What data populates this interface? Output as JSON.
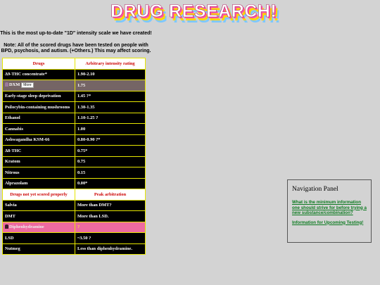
{
  "logo": {
    "text": "DRUG RESEARCH!"
  },
  "intro": {
    "line1": "This is the most up-to-date \"1D\" intensity scale we have created!",
    "line2": "Note: All of the scored drugs have been tested on people with BPD, psychosis, and autism. (+Others.) This may affect scoring."
  },
  "table": {
    "header1": {
      "col1": "Drugs",
      "col2": "Arbitrary intensity rating"
    },
    "scored": [
      {
        "drug": "Δ9-THC concentrate*",
        "rating": "1.90-2.10"
      },
      {
        "drug": "DXM",
        "rating": "1.75",
        "button": "More"
      },
      {
        "drug": "Early-stage sleep deprivation",
        "rating": "1.45 ?*"
      },
      {
        "drug": "Psilocybin-containing mushrooms",
        "rating": "1.30-1.35"
      },
      {
        "drug": "Ethanol",
        "rating": "1.10-1.25 ?"
      },
      {
        "drug": "Cannabis",
        "rating": "1.00"
      },
      {
        "drug": "Ashwagandha KSM-66",
        "rating": "0.80-0.90 ?*"
      },
      {
        "drug": "Δ8-THC",
        "rating": "0.75*"
      },
      {
        "drug": "Kratom",
        "rating": "0.75"
      },
      {
        "drug": "Nitrous",
        "rating": "0.15"
      },
      {
        "drug": "Alprazolam",
        "rating": "0.00*"
      }
    ],
    "header2": {
      "col1": "Drugs not yet scored properly",
      "col2": "Peak arbitration"
    },
    "unscored": [
      {
        "drug": "Salvia",
        "rating": "More than DMT?"
      },
      {
        "drug": "DMT",
        "rating": "More than LSD."
      },
      {
        "drug": "Diphenhydramine",
        "rating": "?"
      },
      {
        "drug": "LSD",
        "rating": "~3.50 ?"
      },
      {
        "drug": "Nutmeg",
        "rating": "Less than diphenhydramine."
      }
    ]
  },
  "nav": {
    "title": "Navigation Panel",
    "links": [
      "What is the minimum information one should strive for before trying a new substance/combination?",
      "Information for Upcoming Testing!"
    ]
  }
}
